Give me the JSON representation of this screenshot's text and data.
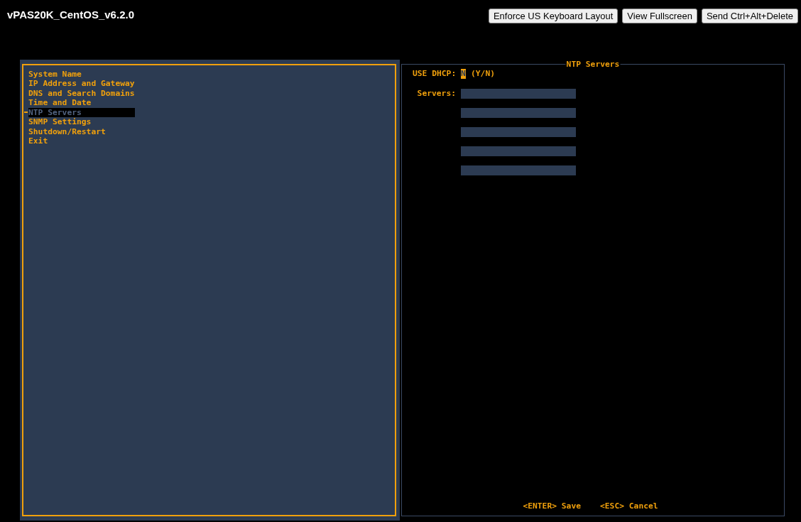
{
  "window": {
    "title": "vPAS20K_CentOS_v6.2.0"
  },
  "toolbar": {
    "buttons": [
      {
        "label": "Enforce US Keyboard Layout"
      },
      {
        "label": "View Fullscreen"
      },
      {
        "label": "Send Ctrl+Alt+Delete"
      }
    ]
  },
  "menu": {
    "items": [
      {
        "label": "System Name",
        "selected": false
      },
      {
        "label": "IP Address and Gateway",
        "selected": false
      },
      {
        "label": "DNS and Search Domains",
        "selected": false
      },
      {
        "label": "Time and Date",
        "selected": false
      },
      {
        "label": "NTP Servers",
        "selected": true
      },
      {
        "label": "SNMP Settings",
        "selected": false
      },
      {
        "label": "Shutdown/Restart",
        "selected": false
      },
      {
        "label": "Exit",
        "selected": false
      }
    ]
  },
  "dialog": {
    "title": "NTP Servers",
    "rows": [
      {
        "kind": "choice",
        "label": "USE DHCP:",
        "value": "N",
        "hint": "(Y/N)",
        "focused": true
      },
      {
        "kind": "inputs",
        "label": "Servers:",
        "inputs": [
          {
            "focused": false
          },
          {
            "focused": false
          },
          {
            "focused": false
          },
          {
            "focused": false
          },
          {
            "focused": false
          }
        ]
      }
    ],
    "keys": [
      "<ENTER> Save",
      "<ESC> Cancel"
    ]
  }
}
